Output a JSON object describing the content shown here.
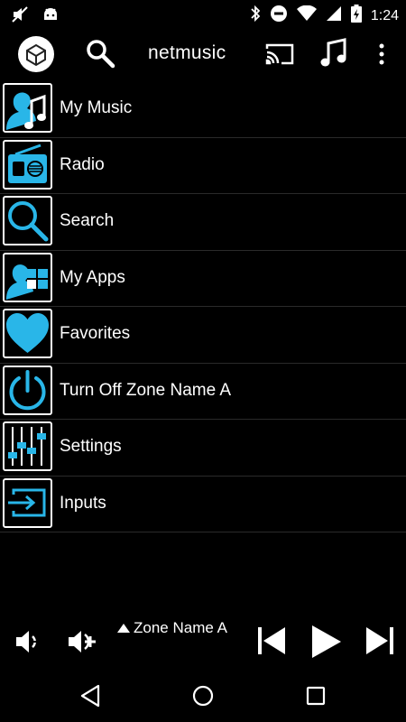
{
  "status_bar": {
    "time": "1:24",
    "icons": [
      "mute-off-icon",
      "android-icon",
      "bluetooth-icon",
      "do-not-disturb-icon",
      "wifi-icon",
      "signal-icon",
      "battery-charging-icon"
    ]
  },
  "app_bar": {
    "title": "netmusic",
    "icons": [
      "app-logo-icon",
      "search-icon",
      "cast-icon",
      "music-note-icon",
      "overflow-menu-icon"
    ]
  },
  "menu": {
    "items": [
      {
        "label": "My Music",
        "icon": "my-music-icon"
      },
      {
        "label": "Radio",
        "icon": "radio-icon"
      },
      {
        "label": "Search",
        "icon": "search-icon"
      },
      {
        "label": "My Apps",
        "icon": "my-apps-icon"
      },
      {
        "label": "Favorites",
        "icon": "heart-icon"
      },
      {
        "label": "Turn Off Zone Name A",
        "icon": "power-icon"
      },
      {
        "label": "Settings",
        "icon": "equalizer-icon"
      },
      {
        "label": "Inputs",
        "icon": "input-icon"
      }
    ]
  },
  "player": {
    "zone_name": "Zone Name A",
    "controls": [
      "volume-down-icon",
      "volume-up-icon",
      "skip-previous-icon",
      "play-icon",
      "skip-next-icon"
    ]
  },
  "nav_bar": {
    "buttons": [
      "back-icon",
      "home-icon",
      "recents-icon"
    ]
  },
  "colors": {
    "background": "#000000",
    "accent": "#29b6e8",
    "text": "#ffffff",
    "divider": "#2a2a2a"
  }
}
